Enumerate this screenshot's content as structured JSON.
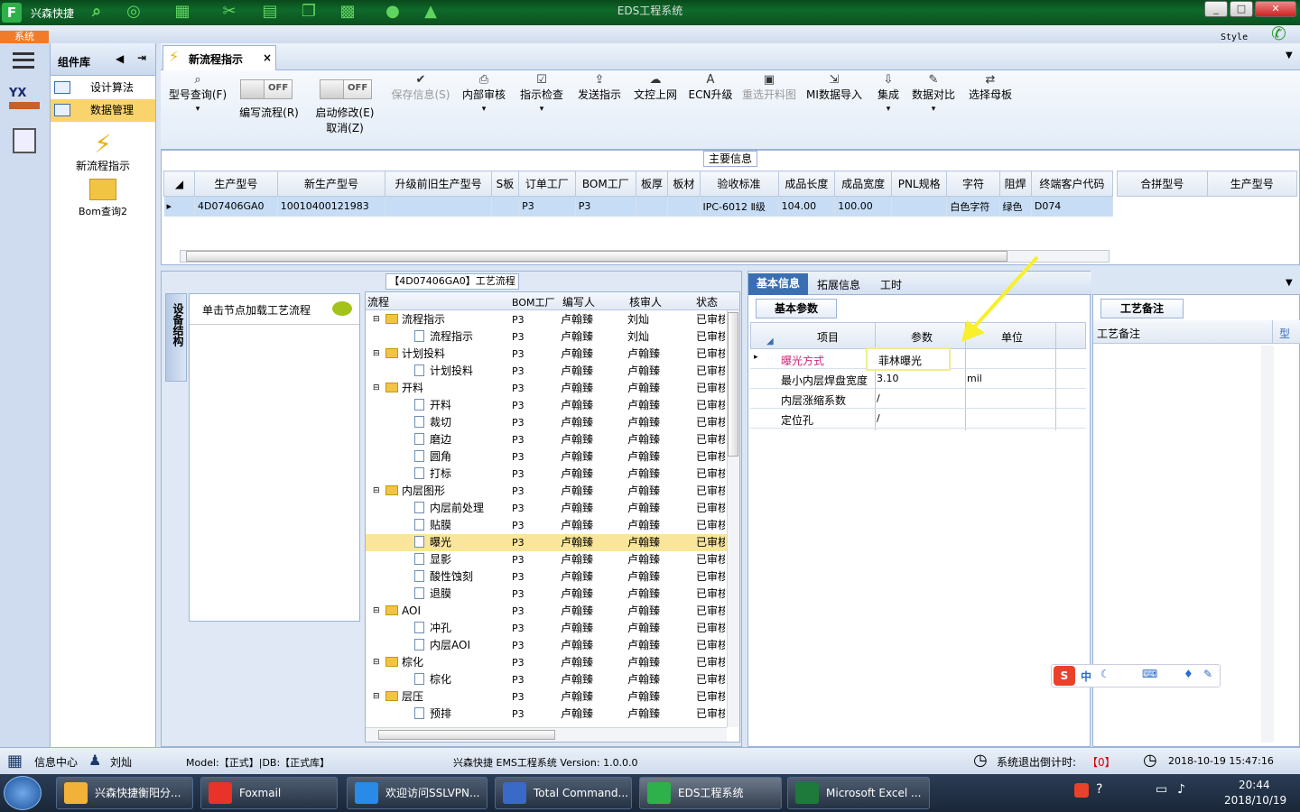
{
  "titlebar": {
    "brand": "兴森快捷",
    "title": "EDS工程系统",
    "min": "_",
    "max": "□",
    "close": "✕"
  },
  "menu": {
    "system": "系统",
    "style": "Style"
  },
  "component_lib": {
    "title": "组件库",
    "items": [
      {
        "label": "设计算法"
      },
      {
        "label": "数据管理"
      }
    ],
    "big_items": [
      {
        "label": "新流程指示"
      },
      {
        "label": "Bom查询2"
      }
    ]
  },
  "tab": {
    "label": "新流程指示",
    "close": "×"
  },
  "ribbon": {
    "query": "型号查询(F)",
    "edit_flow": "编写流程(R)",
    "start_modify": "启动修改(E)",
    "cancel": "取消(Z)",
    "toggle_text": "OFF",
    "save": "保存信息(S)",
    "internal_review": "内部审核",
    "check": "指示检查",
    "send": "发送指示",
    "upload": "文控上网",
    "ecn": "ECN升级",
    "reselect": "重选开料图",
    "mi_import": "MI数据导入",
    "integrate": "集成",
    "compare": "数据对比",
    "select_board": "选择母板"
  },
  "main_info": {
    "title": "主要信息",
    "columns": [
      "生产型号",
      "新生产型号",
      "升级前旧生产型号",
      "S板",
      "订单工厂",
      "BOM工厂",
      "板厚",
      "板材",
      "验收标准",
      "成品长度",
      "成品宽度",
      "PNL规格",
      "字符",
      "阻焊",
      "终端客户代码"
    ],
    "row": [
      "4D07406GA0",
      "10010400121983",
      "",
      "",
      "P3",
      "P3",
      "",
      "",
      "IPC-6012 Ⅱ级",
      "104.00",
      "100.00",
      "",
      "白色字符",
      "绿色",
      "D074"
    ],
    "side_columns": [
      "合拼型号",
      "生产型号"
    ]
  },
  "process": {
    "title": "【4D07406GA0】工艺流程",
    "side_tab": "设备结构",
    "load_hint": "单击节点加载工艺流程",
    "columns": [
      "流程",
      "BOM工厂",
      "编写人",
      "核审人",
      "状态"
    ],
    "rows": [
      {
        "name": "流程指示",
        "level": 0,
        "factory": "P3",
        "writer": "卢翰臻",
        "reviewer": "刘灿",
        "status": "已审核"
      },
      {
        "name": "流程指示",
        "level": 1,
        "factory": "P3",
        "writer": "卢翰臻",
        "reviewer": "刘灿",
        "status": "已审核"
      },
      {
        "name": "计划投料",
        "level": 0,
        "factory": "P3",
        "writer": "卢翰臻",
        "reviewer": "卢翰臻",
        "status": "已审核"
      },
      {
        "name": "计划投料",
        "level": 1,
        "factory": "P3",
        "writer": "卢翰臻",
        "reviewer": "卢翰臻",
        "status": "已审核"
      },
      {
        "name": "开料",
        "level": 0,
        "factory": "P3",
        "writer": "卢翰臻",
        "reviewer": "卢翰臻",
        "status": "已审核"
      },
      {
        "name": "开料",
        "level": 1,
        "factory": "P3",
        "writer": "卢翰臻",
        "reviewer": "卢翰臻",
        "status": "已审核"
      },
      {
        "name": "裁切",
        "level": 1,
        "factory": "P3",
        "writer": "卢翰臻",
        "reviewer": "卢翰臻",
        "status": "已审核"
      },
      {
        "name": "磨边",
        "level": 1,
        "factory": "P3",
        "writer": "卢翰臻",
        "reviewer": "卢翰臻",
        "status": "已审核"
      },
      {
        "name": "圆角",
        "level": 1,
        "factory": "P3",
        "writer": "卢翰臻",
        "reviewer": "卢翰臻",
        "status": "已审核"
      },
      {
        "name": "打标",
        "level": 1,
        "factory": "P3",
        "writer": "卢翰臻",
        "reviewer": "卢翰臻",
        "status": "已审核"
      },
      {
        "name": "内层图形",
        "level": 0,
        "factory": "P3",
        "writer": "卢翰臻",
        "reviewer": "卢翰臻",
        "status": "已审核"
      },
      {
        "name": "内层前处理",
        "level": 1,
        "factory": "P3",
        "writer": "卢翰臻",
        "reviewer": "卢翰臻",
        "status": "已审核"
      },
      {
        "name": "贴膜",
        "level": 1,
        "factory": "P3",
        "writer": "卢翰臻",
        "reviewer": "卢翰臻",
        "status": "已审核"
      },
      {
        "name": "曝光",
        "level": 1,
        "factory": "P3",
        "writer": "卢翰臻",
        "reviewer": "卢翰臻",
        "status": "已审核",
        "selected": true
      },
      {
        "name": "显影",
        "level": 1,
        "factory": "P3",
        "writer": "卢翰臻",
        "reviewer": "卢翰臻",
        "status": "已审核"
      },
      {
        "name": "酸性蚀刻",
        "level": 1,
        "factory": "P3",
        "writer": "卢翰臻",
        "reviewer": "卢翰臻",
        "status": "已审核"
      },
      {
        "name": "退膜",
        "level": 1,
        "factory": "P3",
        "writer": "卢翰臻",
        "reviewer": "卢翰臻",
        "status": "已审核"
      },
      {
        "name": "AOI",
        "level": 0,
        "factory": "P3",
        "writer": "卢翰臻",
        "reviewer": "卢翰臻",
        "status": "已审核"
      },
      {
        "name": "冲孔",
        "level": 1,
        "factory": "P3",
        "writer": "卢翰臻",
        "reviewer": "卢翰臻",
        "status": "已审核"
      },
      {
        "name": "内层AOI",
        "level": 1,
        "factory": "P3",
        "writer": "卢翰臻",
        "reviewer": "卢翰臻",
        "status": "已审核"
      },
      {
        "name": "棕化",
        "level": 0,
        "factory": "P3",
        "writer": "卢翰臻",
        "reviewer": "卢翰臻",
        "status": "已审核"
      },
      {
        "name": "棕化",
        "level": 1,
        "factory": "P3",
        "writer": "卢翰臻",
        "reviewer": "卢翰臻",
        "status": "已审核"
      },
      {
        "name": "层压",
        "level": 0,
        "factory": "P3",
        "writer": "卢翰臻",
        "reviewer": "卢翰臻",
        "status": "已审核"
      },
      {
        "name": "预排",
        "level": 1,
        "factory": "P3",
        "writer": "卢翰臻",
        "reviewer": "卢翰臻",
        "status": "已审核"
      }
    ]
  },
  "right_tabs": [
    "基本信息",
    "拓展信息",
    "工时"
  ],
  "basic_params": {
    "title": "基本参数",
    "columns": [
      "项目",
      "参数",
      "单位"
    ],
    "rows": [
      {
        "item": "曝光方式",
        "param": "菲林曝光",
        "unit": ""
      },
      {
        "item": "最小内层焊盘宽度",
        "param": "3.10",
        "unit": "mil"
      },
      {
        "item": "内层涨缩系数",
        "param": "/",
        "unit": ""
      },
      {
        "item": "定位孔",
        "param": "/",
        "unit": ""
      }
    ]
  },
  "notes": {
    "tab": "工艺备注",
    "col1": "工艺备注",
    "col2": "型"
  },
  "ime": {
    "label": "中"
  },
  "status_bar": {
    "info_center": "信息中心",
    "user": "刘灿",
    "model": "Model:【正式】|DB:【正式库】",
    "app": "兴森快捷 EMS工程系统 Version: 1.0.0.0",
    "exit_label": "系统退出倒计时:",
    "exit_count": "【0】",
    "datetime": "2018-10-19 15:47:16"
  },
  "taskbar": {
    "items": [
      "兴森快捷衡阳分...",
      "Foxmail",
      "欢迎访问SSLVPN...",
      "Total Command...",
      "EDS工程系统",
      "Microsoft Excel ..."
    ],
    "time": "20:44",
    "date": "2018/10/19"
  },
  "colors": {
    "accent": "#0f6a2a",
    "selected_row": "#f9e69a",
    "highlight_item": "#d4267a",
    "arrow": "#f7f02a"
  }
}
